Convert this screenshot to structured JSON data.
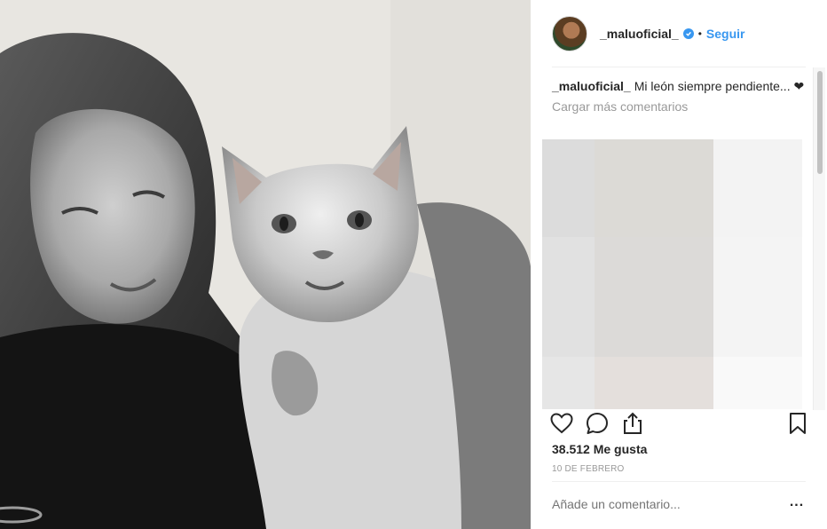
{
  "post": {
    "username": "_maluoficial_",
    "follow_label": "Seguir",
    "separator": "•",
    "caption_text": "Mi león siempre pendiente... ❤",
    "load_more_label": "Cargar más comentarios",
    "likes": "38.512 Me gusta",
    "date": "10 DE FEBRERO",
    "comment_placeholder": "Añade un comentario...",
    "more_options_label": "..."
  },
  "icons": {
    "like": "heart-outline-icon",
    "comment": "speech-bubble-icon",
    "share": "share-upload-icon",
    "save": "bookmark-icon",
    "verified": "verified-badge-icon"
  },
  "colors": {
    "accent": "#3897f0",
    "text": "#262626",
    "muted": "#999999",
    "divider": "#efefef"
  }
}
